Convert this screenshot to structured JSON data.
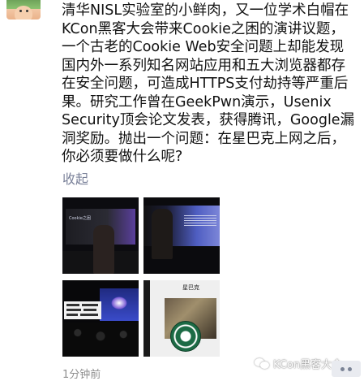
{
  "post": {
    "text": "清华NISL实验室的小鲜肉，又一位学术白帽在KCon黑客大会带来Cookie之困的演讲议题，一个古老的Cookie Web安全问题上却能发现国内外一系列知名网站应用和五大浏览器都存在安全问题，可造成HTTPS支付劫持等严重后果。研究工作曾在GeekPwn演示，Usenix Security顶会论文发表，获得腾讯，Google漏洞奖励。抛出一个问题：在星巴克上网之后，你必须要做什么呢?",
    "collapse_label": "收起",
    "timestamp": "1分钟前"
  },
  "photos": [
    {
      "caption_text": "Cookie之困"
    },
    {
      "caption_text": ""
    },
    {
      "caption_text": ""
    },
    {
      "caption_text": "星巴克"
    }
  ],
  "watermark": {
    "text": "KCon黑客大会",
    "icon": "wechat-icon"
  },
  "icons": {
    "more": "more-dots-icon"
  },
  "colors": {
    "link": "#7a8199",
    "time": "#8e8e8e",
    "starbucks_green": "#1c6b45"
  }
}
